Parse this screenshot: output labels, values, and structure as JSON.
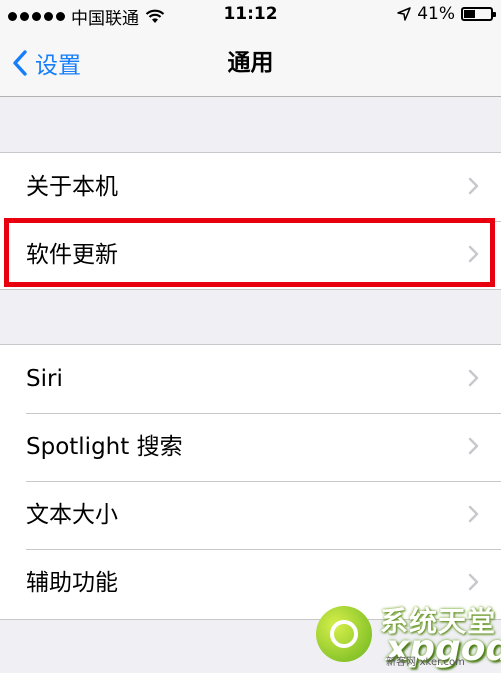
{
  "status_bar": {
    "carrier": "中国联通",
    "time": "11:12",
    "battery": "41%"
  },
  "nav": {
    "back_label": "设置",
    "title": "通用"
  },
  "groups": [
    {
      "items": [
        {
          "label": "关于本机"
        },
        {
          "label": "软件更新"
        }
      ]
    },
    {
      "items": [
        {
          "label": "Siri"
        },
        {
          "label": "Spotlight 搜索"
        },
        {
          "label": "文本大小"
        },
        {
          "label": "辅助功能"
        }
      ]
    }
  ],
  "highlight": {
    "item": "软件更新",
    "color": "#e8000f"
  },
  "colors": {
    "accent": "#167efb",
    "background": "#efeff4",
    "separator": "#c8c7cc"
  },
  "watermark": {
    "title": "系统天堂",
    "brand": "xpgod",
    "site": "新客网-xker.com"
  },
  "icons": [
    "wifi-icon",
    "location-arrow-icon",
    "battery-icon",
    "back-chevron-icon",
    "disclosure-chevron-icon"
  ]
}
